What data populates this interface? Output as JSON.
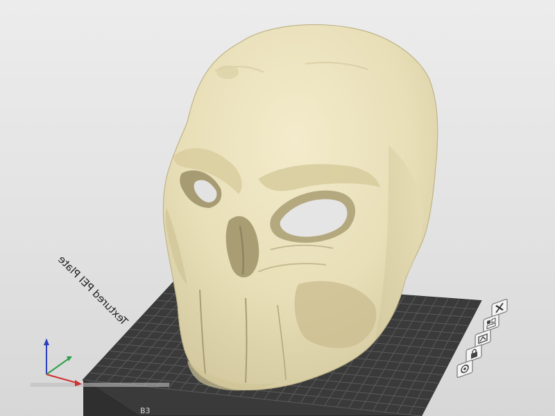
{
  "viewport": {
    "background_color": "#e5e5e5",
    "model_color": "#ece3c0",
    "model_name": "skull mask"
  },
  "bed": {
    "plate_label": "Textured PEI Plate",
    "plate_color": "#3a3a3a",
    "grid_color": "#5a5a5a",
    "corner_label": "B3"
  },
  "axes": {
    "x_color": "#d03030",
    "y_color": "#2fa04a",
    "z_color": "#2a3fbf"
  },
  "plate_toolbar": {
    "buttons": [
      {
        "name": "close-plate-button",
        "icon": "close-icon"
      },
      {
        "name": "arrange-plate-button",
        "icon": "arrange-icon"
      },
      {
        "name": "orient-plate-button",
        "icon": "orient-icon"
      },
      {
        "name": "lock-plate-button",
        "icon": "lock-icon"
      },
      {
        "name": "plate-settings-button",
        "icon": "gear-icon"
      }
    ]
  }
}
